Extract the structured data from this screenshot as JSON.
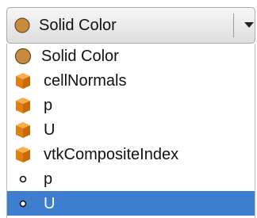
{
  "combo": {
    "selected_label": "Solid Color",
    "selected_icon": "solid-color-circle"
  },
  "list": {
    "items": [
      {
        "label": "Solid Color",
        "icon": "solid-color-circle"
      },
      {
        "label": "cellNormals",
        "icon": "cell-data-cube"
      },
      {
        "label": "p",
        "icon": "cell-data-cube"
      },
      {
        "label": "U",
        "icon": "cell-data-cube"
      },
      {
        "label": "vtkCompositeIndex",
        "icon": "cell-data-cube"
      },
      {
        "label": "p",
        "icon": "point-data-dot"
      },
      {
        "label": "U",
        "icon": "point-data-dot"
      }
    ],
    "selected_index": 6
  },
  "colors": {
    "solid_color": "#c98a3d",
    "cell_cube": "#e58a1f",
    "selection": "#3e7ece"
  }
}
